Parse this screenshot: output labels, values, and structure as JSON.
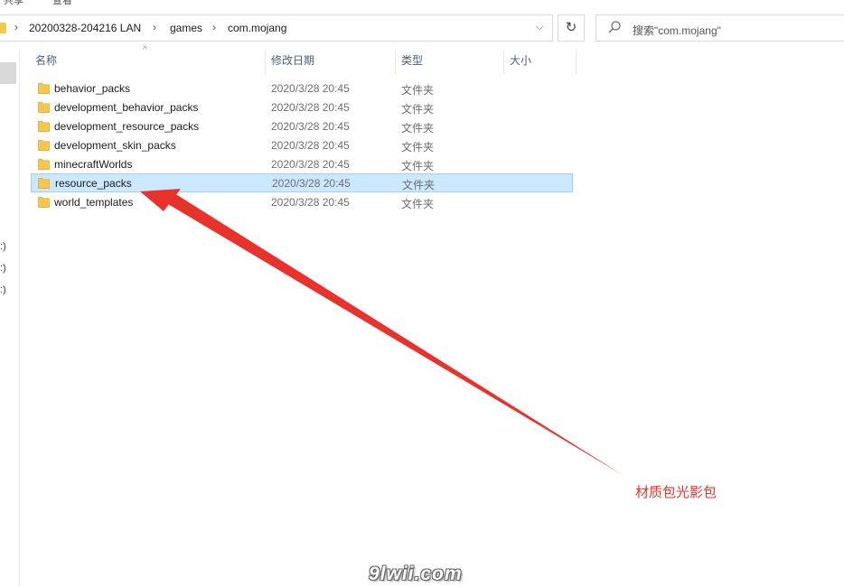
{
  "topbar": {
    "frag1": "共享",
    "frag2": "查看"
  },
  "address": {
    "crumbs": [
      "20200328-204216 LAN",
      "games",
      "com.mojang"
    ]
  },
  "search": {
    "placeholder": "搜索\"com.mojang\""
  },
  "navpane": {
    "drives": [
      ":)",
      ":)",
      ":)"
    ]
  },
  "columns": {
    "name": "名称",
    "date": "修改日期",
    "type": "类型",
    "size": "大小"
  },
  "files": [
    {
      "name": "behavior_packs",
      "date": "2020/3/28 20:45",
      "type": "文件夹"
    },
    {
      "name": "development_behavior_packs",
      "date": "2020/3/28 20:45",
      "type": "文件夹"
    },
    {
      "name": "development_resource_packs",
      "date": "2020/3/28 20:45",
      "type": "文件夹"
    },
    {
      "name": "development_skin_packs",
      "date": "2020/3/28 20:45",
      "type": "文件夹"
    },
    {
      "name": "minecraftWorlds",
      "date": "2020/3/28 20:45",
      "type": "文件夹"
    },
    {
      "name": "resource_packs",
      "date": "2020/3/28 20:45",
      "type": "文件夹"
    },
    {
      "name": "world_templates",
      "date": "2020/3/28 20:45",
      "type": "文件夹"
    }
  ],
  "selected_index": 5,
  "annotation": {
    "text": "材质包光影包",
    "color": "#e8322c"
  },
  "watermark": "9lwii.com",
  "colors": {
    "selection_bg": "#cce8ff",
    "selection_border": "#99d1ff",
    "folder": "#f5c84c",
    "header_text": "#4c607a"
  },
  "icons": {
    "folder": "folder-icon",
    "search": "search-icon",
    "refresh": "refresh-icon",
    "chevron": "chevron-down-icon"
  }
}
